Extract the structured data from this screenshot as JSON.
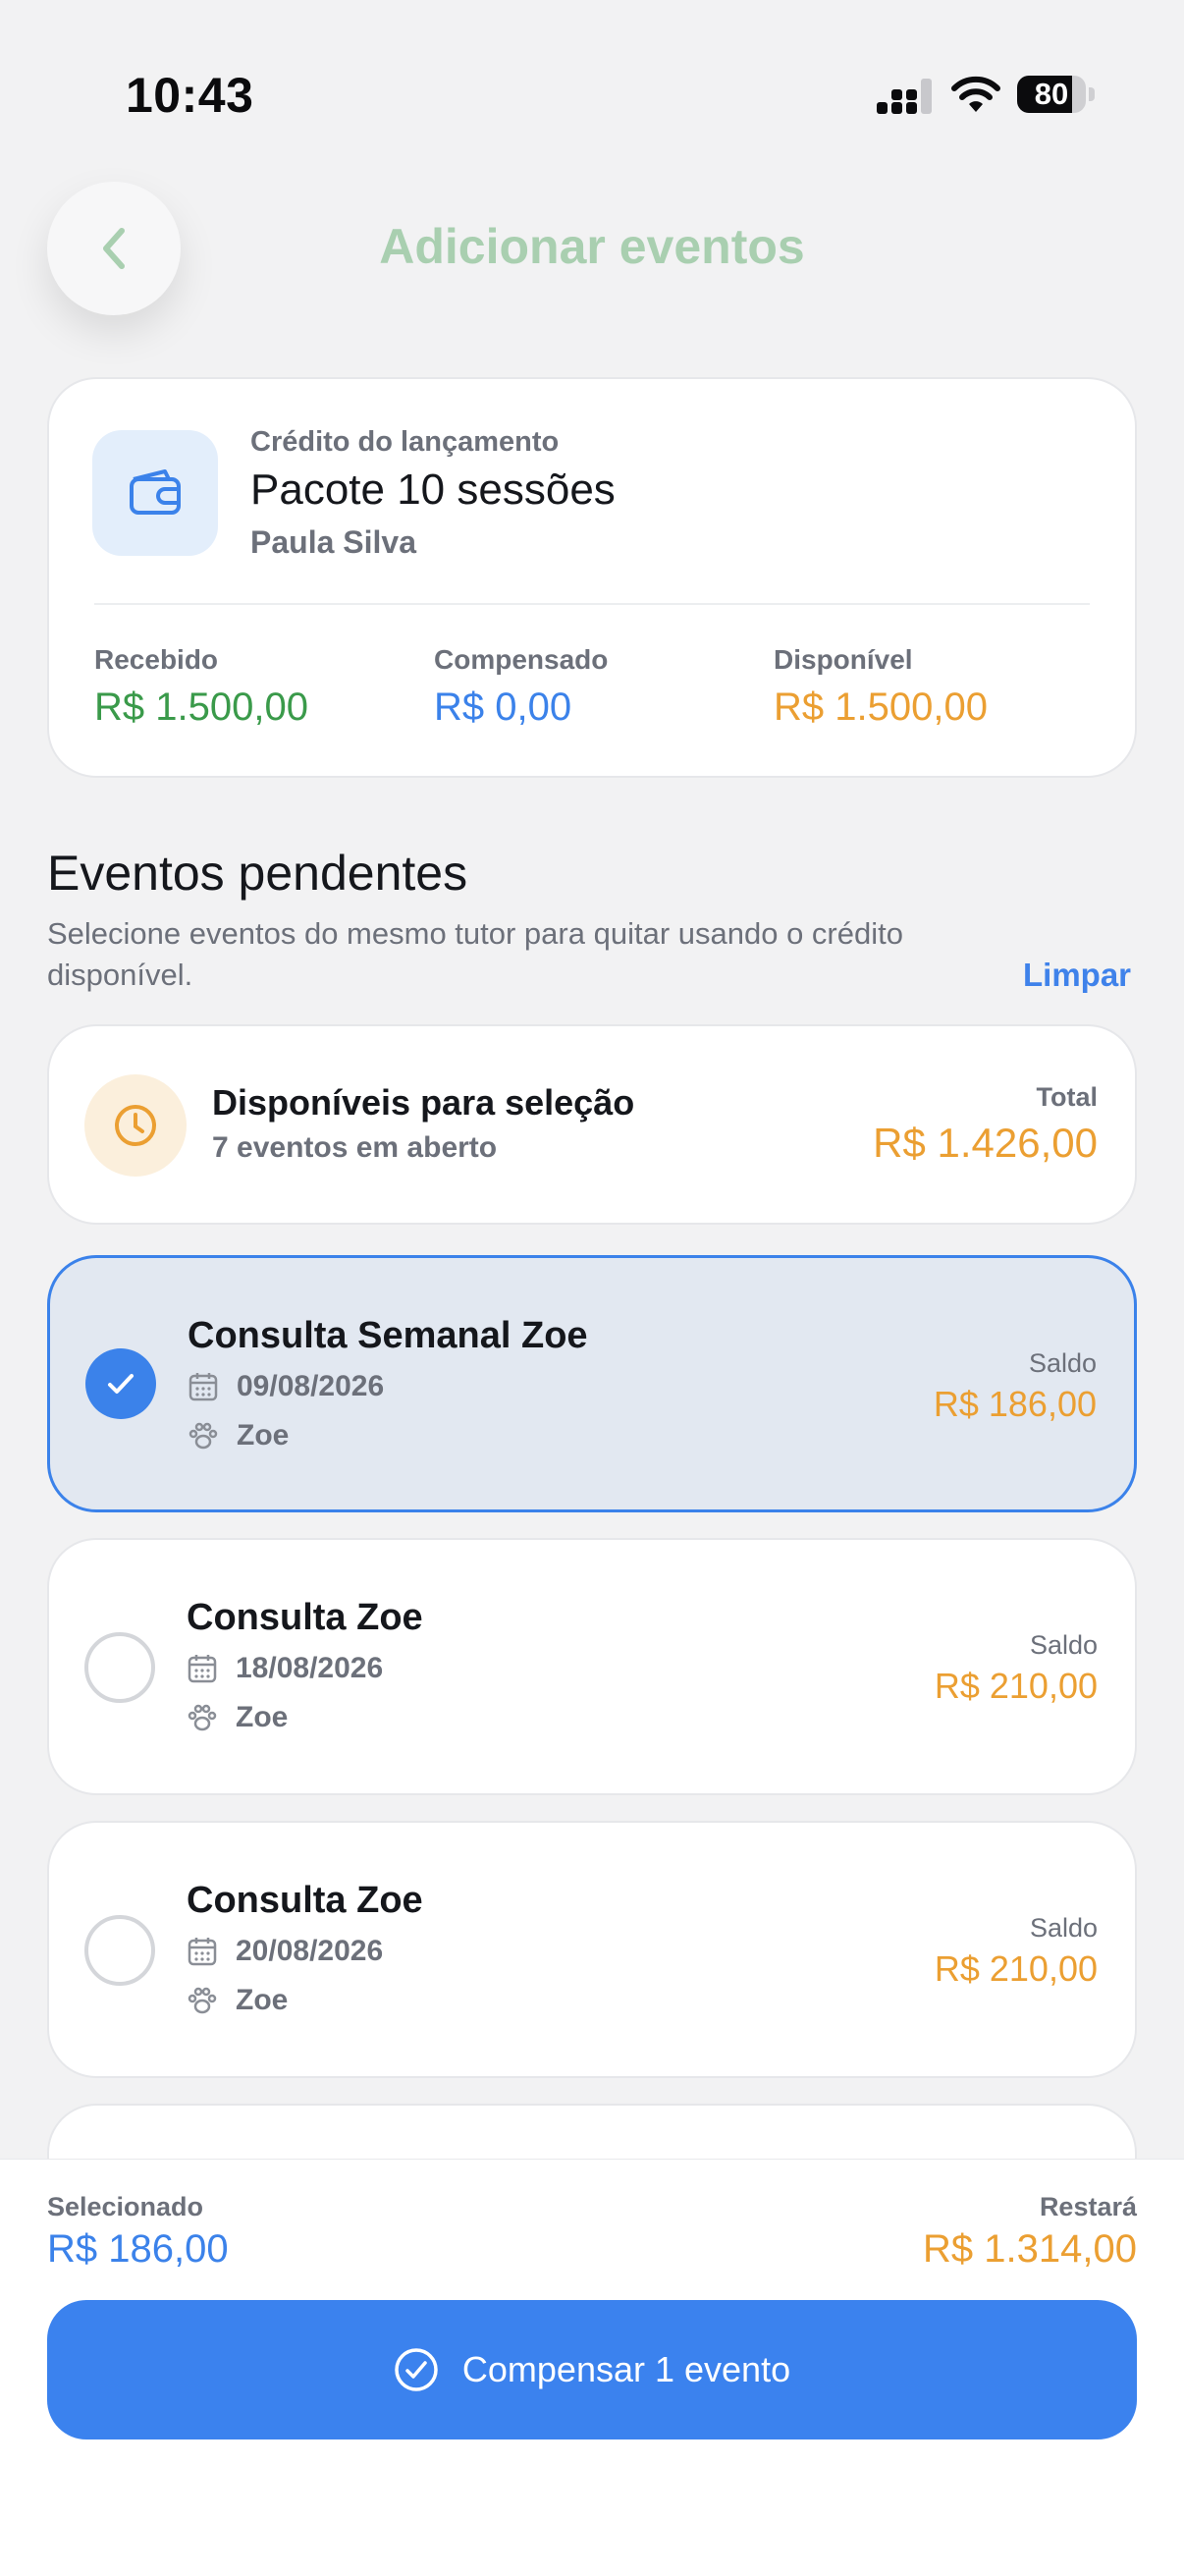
{
  "status_bar": {
    "time": "10:43",
    "battery": "80",
    "battery_level": 0.8
  },
  "header": {
    "title": "Adicionar eventos",
    "back_icon": "chevron-left-icon"
  },
  "credit": {
    "label": "Crédito do lançamento",
    "title": "Pacote 10 sessões",
    "client": "Paula Silva",
    "icon": "wallet-icon",
    "stats": [
      {
        "label": "Recebido",
        "value": "R$ 1.500,00",
        "color": "#3a9a4a"
      },
      {
        "label": "Compensado",
        "value": "R$ 0,00",
        "color": "#3b82ea"
      },
      {
        "label": "Disponível",
        "value": "R$ 1.500,00",
        "color": "#eb9f32"
      }
    ]
  },
  "pending": {
    "title": "Eventos pendentes",
    "description": "Selecione eventos do mesmo tutor para quitar usando o crédito disponível.",
    "clear_label": "Limpar"
  },
  "summary": {
    "title": "Disponíveis para seleção",
    "subtitle": "7 eventos em aberto",
    "total_label": "Total",
    "total_value": "R$ 1.426,00",
    "icon": "clock-icon"
  },
  "events": [
    {
      "title": "Consulta Semanal Zoe",
      "date": "09/08/2026",
      "pet": "Zoe",
      "saldo_label": "Saldo",
      "saldo": "R$ 186,00",
      "selected": true
    },
    {
      "title": "Consulta Zoe",
      "date": "18/08/2026",
      "pet": "Zoe",
      "saldo_label": "Saldo",
      "saldo": "R$ 210,00",
      "selected": false
    },
    {
      "title": "Consulta Zoe",
      "date": "20/08/2026",
      "pet": "Zoe",
      "saldo_label": "Saldo",
      "saldo": "R$ 210,00",
      "selected": false
    }
  ],
  "footer": {
    "selected_label": "Selecionado",
    "selected_value": "R$ 186,00",
    "remaining_label": "Restará",
    "remaining_value": "R$ 1.314,00",
    "button_label": "Compensar 1 evento"
  }
}
